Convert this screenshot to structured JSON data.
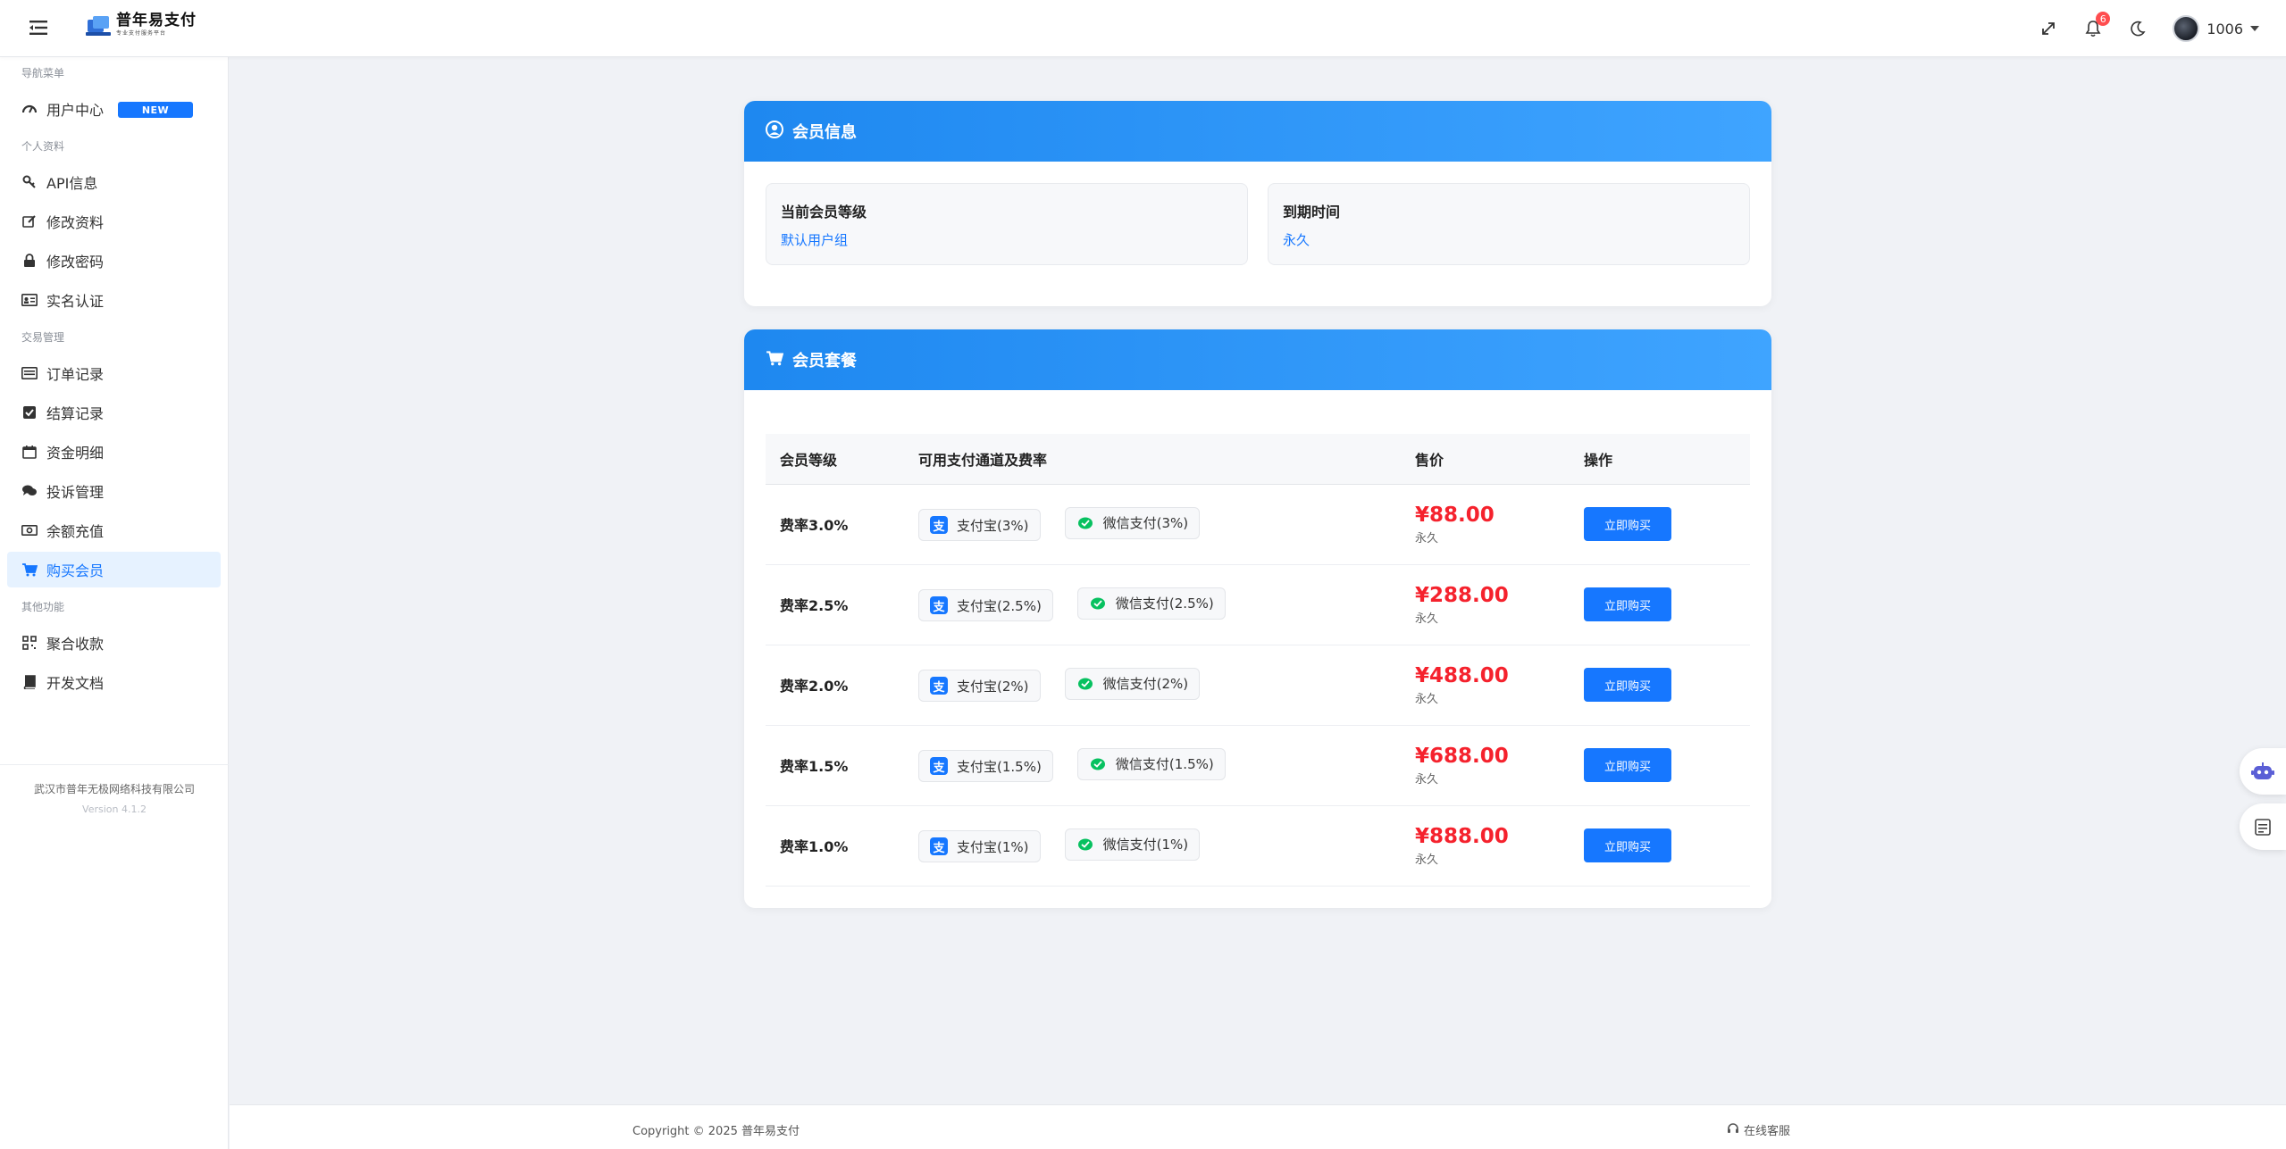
{
  "brand": {
    "title": "普年易支付",
    "subtitle": "专业支付服务平台"
  },
  "header": {
    "notification_count": "6",
    "user_name": "1006"
  },
  "sidebar": {
    "groups": [
      {
        "label": "导航菜单"
      },
      {
        "label": "个人资料"
      },
      {
        "label": "交易管理"
      },
      {
        "label": "其他功能"
      }
    ],
    "items": [
      {
        "label": "用户中心",
        "icon": "dashboard-icon",
        "tag": "NEW"
      },
      {
        "label": "API信息",
        "icon": "key-icon"
      },
      {
        "label": "修改资料",
        "icon": "edit-icon"
      },
      {
        "label": "修改密码",
        "icon": "lock-icon"
      },
      {
        "label": "实名认证",
        "icon": "id-card-icon"
      },
      {
        "label": "订单记录",
        "icon": "list-icon"
      },
      {
        "label": "结算记录",
        "icon": "check-square-icon"
      },
      {
        "label": "资金明细",
        "icon": "calendar-icon"
      },
      {
        "label": "投诉管理",
        "icon": "comments-icon"
      },
      {
        "label": "余额充值",
        "icon": "money-icon"
      },
      {
        "label": "购买会员",
        "icon": "cart-icon",
        "active": true
      },
      {
        "label": "聚合收款",
        "icon": "qrcode-icon"
      },
      {
        "label": "开发文档",
        "icon": "book-icon"
      }
    ],
    "footer_company": "武汉市普年无极网络科技有限公司",
    "footer_version": "Version 4.1.2"
  },
  "member_info": {
    "title": "会员信息",
    "level_label": "当前会员等级",
    "level_value": "默认用户组",
    "expire_label": "到期时间",
    "expire_value": "永久"
  },
  "plans": {
    "title": "会员套餐",
    "columns": [
      "会员等级",
      "可用支付通道及费率",
      "售价",
      "操作"
    ],
    "rows": [
      {
        "tier": "费率3.0%",
        "alipay": "支付宝(3%)",
        "wechat": "微信支付(3%)",
        "price": "¥88.00",
        "duration": "永久",
        "action": "立即购买"
      },
      {
        "tier": "费率2.5%",
        "alipay": "支付宝(2.5%)",
        "wechat": "微信支付(2.5%)",
        "price": "¥288.00",
        "duration": "永久",
        "action": "立即购买"
      },
      {
        "tier": "费率2.0%",
        "alipay": "支付宝(2%)",
        "wechat": "微信支付(2%)",
        "price": "¥488.00",
        "duration": "永久",
        "action": "立即购买"
      },
      {
        "tier": "费率1.5%",
        "alipay": "支付宝(1.5%)",
        "wechat": "微信支付(1.5%)",
        "price": "¥688.00",
        "duration": "永久",
        "action": "立即购买"
      },
      {
        "tier": "费率1.0%",
        "alipay": "支付宝(1%)",
        "wechat": "微信支付(1%)",
        "price": "¥888.00",
        "duration": "永久",
        "action": "立即购买"
      }
    ],
    "alipay_glyph": "支"
  },
  "footer": {
    "copyright": "Copyright © 2025 普年易支付",
    "support": "在线客服"
  },
  "colors": {
    "accent": "#1677ff",
    "header_gradient_start": "#1e88f0",
    "header_gradient_end": "#3fa4ff",
    "price": "#f5222d",
    "wechat": "#07c160"
  }
}
